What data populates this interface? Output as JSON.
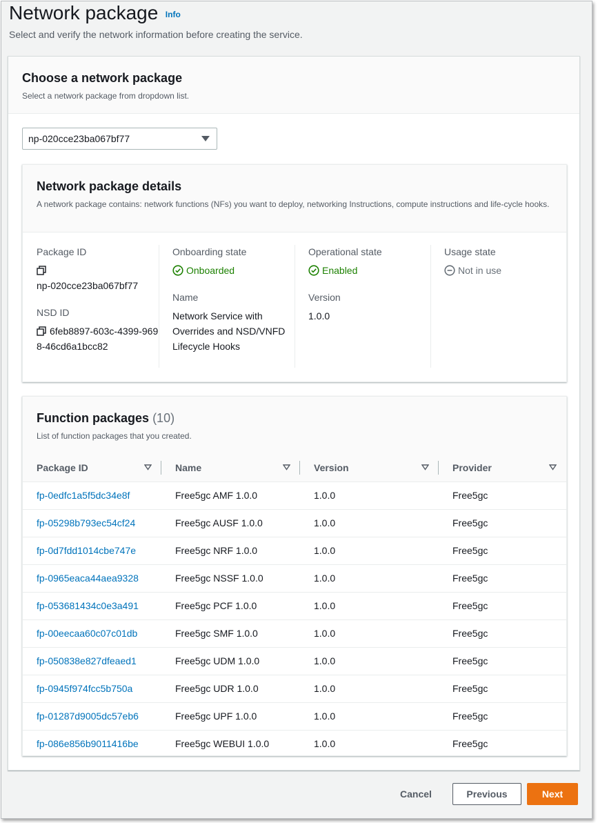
{
  "header": {
    "title": "Network package",
    "info_label": "Info",
    "description": "Select and verify the network information before creating the service."
  },
  "chooser": {
    "title": "Choose a network package",
    "description": "Select a network package from dropdown list.",
    "selected_value": "np-020cce23ba067bf77"
  },
  "details": {
    "title": "Network package details",
    "description": "A network package contains: network functions (NFs) you want to deploy, networking Instructions, compute instructions and life-cycle hooks.",
    "package_id_label": "Package ID",
    "package_id": "np-020cce23ba067bf77",
    "nsd_id_label": "NSD ID",
    "nsd_id": "6feb8897-603c-4399-9698-46cd6a1bcc82",
    "onboarding_label": "Onboarding state",
    "onboarding_value": "Onboarded",
    "name_label": "Name",
    "name_value": "Network Service with Overrides and NSD/VNFD Lifecycle Hooks",
    "operational_label": "Operational state",
    "operational_value": "Enabled",
    "version_label": "Version",
    "version_value": "1.0.0",
    "usage_label": "Usage state",
    "usage_value": "Not in use",
    "colors": {
      "success": "#1d8102",
      "muted": "#687078"
    }
  },
  "functions": {
    "title": "Function packages",
    "count": "(10)",
    "description": "List of function packages that you created.",
    "columns": [
      "Package ID",
      "Name",
      "Version",
      "Provider"
    ],
    "rows": [
      {
        "id": "fp-0edfc1a5f5dc34e8f",
        "name": "Free5gc AMF 1.0.0",
        "version": "1.0.0",
        "provider": "Free5gc"
      },
      {
        "id": "fp-05298b793ec54cf24",
        "name": "Free5gc AUSF 1.0.0",
        "version": "1.0.0",
        "provider": "Free5gc"
      },
      {
        "id": "fp-0d7fdd1014cbe747e",
        "name": "Free5gc NRF 1.0.0",
        "version": "1.0.0",
        "provider": "Free5gc"
      },
      {
        "id": "fp-0965eaca44aea9328",
        "name": "Free5gc NSSF 1.0.0",
        "version": "1.0.0",
        "provider": "Free5gc"
      },
      {
        "id": "fp-053681434c0e3a491",
        "name": "Free5gc PCF 1.0.0",
        "version": "1.0.0",
        "provider": "Free5gc"
      },
      {
        "id": "fp-00eecaa60c07c01db",
        "name": "Free5gc SMF 1.0.0",
        "version": "1.0.0",
        "provider": "Free5gc"
      },
      {
        "id": "fp-050838e827dfeaed1",
        "name": "Free5gc UDM 1.0.0",
        "version": "1.0.0",
        "provider": "Free5gc"
      },
      {
        "id": "fp-0945f974fcc5b750a",
        "name": "Free5gc UDR 1.0.0",
        "version": "1.0.0",
        "provider": "Free5gc"
      },
      {
        "id": "fp-01287d9005dc57eb6",
        "name": "Free5gc UPF 1.0.0",
        "version": "1.0.0",
        "provider": "Free5gc"
      },
      {
        "id": "fp-086e856b9011416be",
        "name": "Free5gc WEBUI 1.0.0",
        "version": "1.0.0",
        "provider": "Free5gc"
      }
    ]
  },
  "actions": {
    "cancel": "Cancel",
    "previous": "Previous",
    "next": "Next",
    "primary_color": "#ec7211"
  }
}
